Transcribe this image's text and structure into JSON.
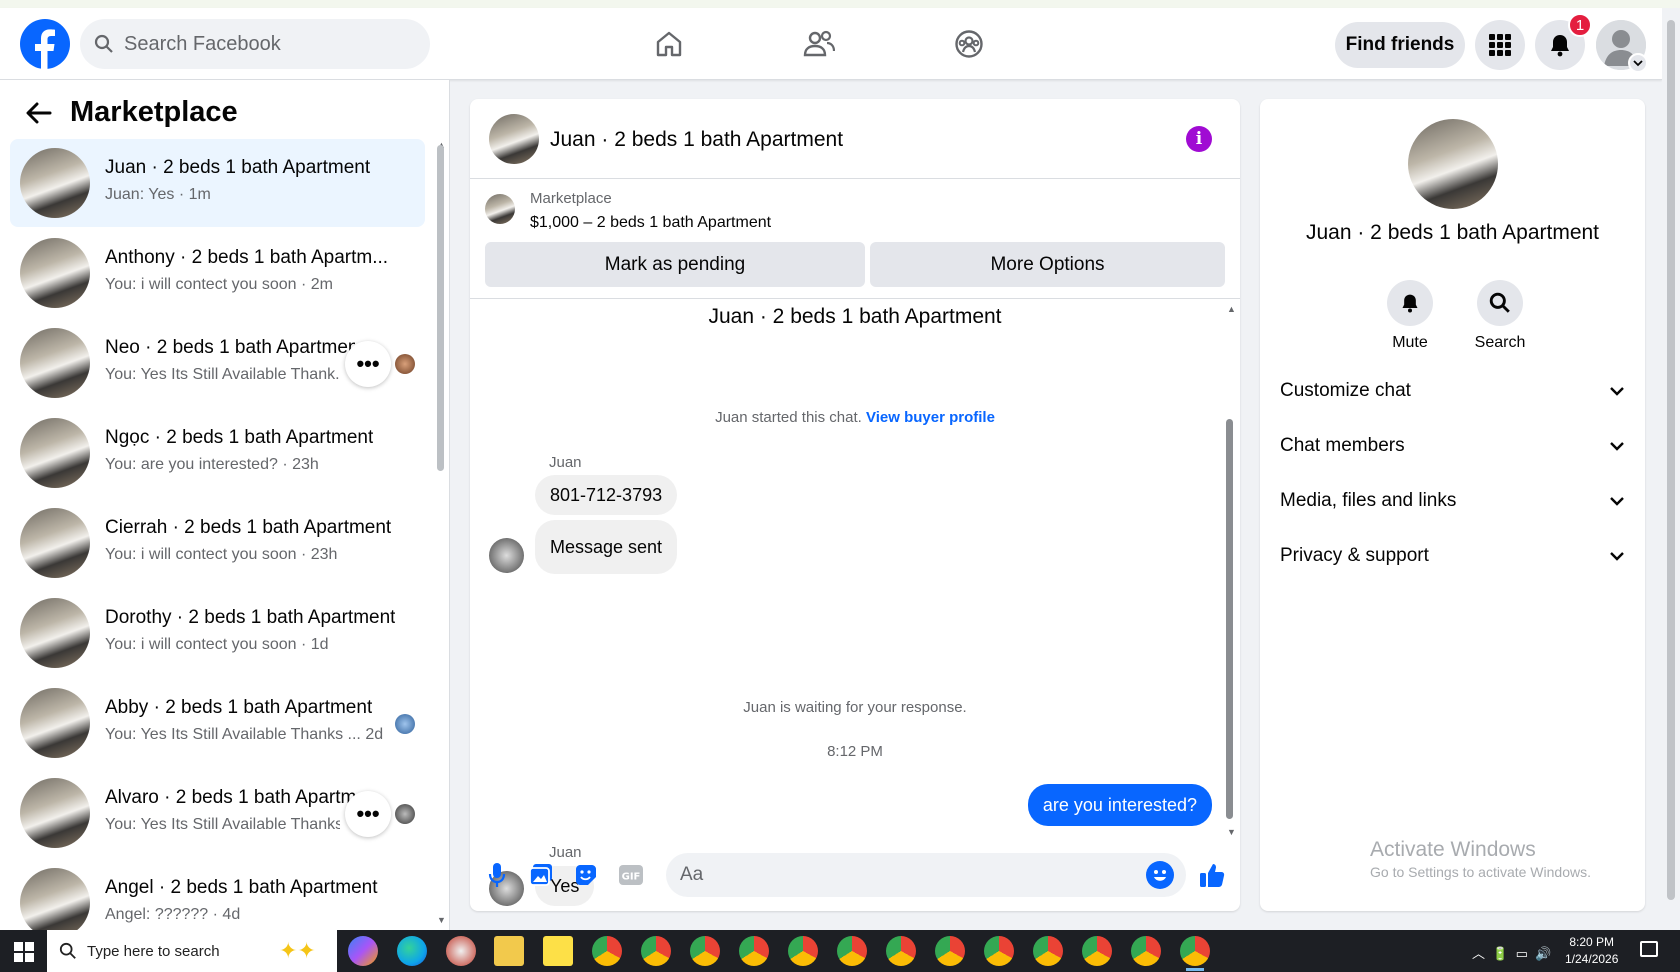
{
  "header": {
    "search_placeholder": "Search Facebook",
    "find_friends_label": "Find friends",
    "notification_count": "1"
  },
  "sidebar": {
    "title": "Marketplace",
    "conversations": [
      {
        "title": "Juan · 2 beds 1 bath Apartment",
        "subtitle": "Juan: Yes · 1m",
        "active": true
      },
      {
        "title": "Anthony · 2 beds 1 bath Apartm...",
        "subtitle": "You: i will contect you soon · 2m"
      },
      {
        "title": "Neo · 2 beds 1 bath Apartment",
        "subtitle": "You: Yes Its Still Available Thank..."
      },
      {
        "title": "Ngọc · 2 beds 1 bath Apartment",
        "subtitle": "You: are you interested? · 23h"
      },
      {
        "title": "Cierrah · 2 beds 1 bath Apartment",
        "subtitle": "You: i will contect you soon · 23h"
      },
      {
        "title": "Dorothy · 2 beds 1 bath Apartment",
        "subtitle": "You: i will contect you soon · 1d"
      },
      {
        "title": "Abby · 2 beds 1 bath Apartment",
        "subtitle": "You: Yes Its Still Available Thanks ...  2d"
      },
      {
        "title": "Alvaro · 2 beds 1 bath Apartment",
        "subtitle": "You: Yes Its Still Available Thanks ..."
      },
      {
        "title": "Angel · 2 beds 1 bath Apartment",
        "subtitle": "Angel: ?????? · 4d"
      }
    ],
    "more_glyph": "•••"
  },
  "chat": {
    "header_title": "Juan · 2 beds 1 bath Apartment",
    "listing": {
      "category": "Marketplace",
      "price_title": "$1,000 – 2 beds 1 bath Apartment",
      "mark_pending_label": "Mark as pending",
      "more_options_label": "More Options"
    },
    "thread_title": "Juan · 2 beds 1 bath Apartment",
    "started_text": "Juan started this chat.",
    "view_profile_link": "View buyer profile",
    "messages": [
      {
        "sender": "Juan",
        "text": "801-712-3793"
      },
      {
        "text": "Message sent"
      },
      {
        "text": "are you interested?",
        "outgoing": true
      },
      {
        "sender": "Juan",
        "text": "Yes"
      }
    ],
    "waiting_text": "Juan is waiting for your response.",
    "timestamp": "8:12 PM",
    "composer_placeholder": "Aa",
    "accent_color": "#0866ff"
  },
  "details": {
    "title": "Juan · 2 beds 1 bath Apartment",
    "mute_label": "Mute",
    "search_label": "Search",
    "sections": [
      "Customize chat",
      "Chat members",
      "Media, files and links",
      "Privacy & support"
    ]
  },
  "watermark": {
    "line1": "Activate Windows",
    "line2": "Go to Settings to activate Windows."
  },
  "taskbar": {
    "search_placeholder": "Type here to search",
    "time": "8:20 PM",
    "date": "1/24/2026"
  }
}
